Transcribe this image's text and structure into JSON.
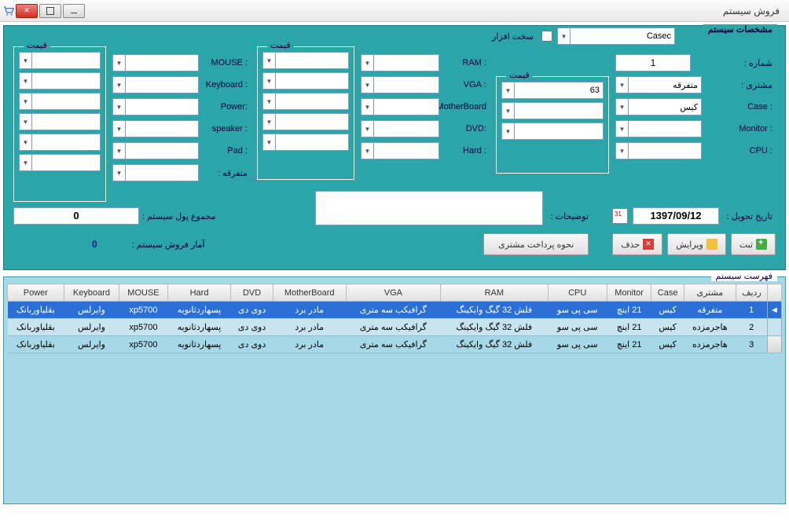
{
  "window": {
    "title": "فروش سیستم"
  },
  "specs": {
    "group_title": "مشخصات سیستم",
    "hardware_label": "سخت افزار",
    "hardware_value": "Casec",
    "number_label": "شماره :",
    "number_value": "1",
    "customer_label": "مشتری :",
    "customer_value": "متفرقه",
    "case_label": ": Case",
    "case_value": "کیس",
    "monitor_label": ": Monitor",
    "cpu_label": ": CPU",
    "price_group": "قیمت",
    "price_case": "63",
    "ram_label": ": RAM",
    "vga_label": ": VGA",
    "mb_label": "MotherBoard",
    "dvd_label": ":DVD",
    "hard_label": ": Hard",
    "mouse_label": ": MOUSE",
    "keyboard_label": ": Keyboard",
    "power_label": ":Power",
    "speaker_label": ": speaker",
    "pad_label": ": Pad",
    "misc_label": "متفرقه :",
    "delivery_label": "تاریخ تحویل :",
    "delivery_value": "1397/09/12",
    "desc_label": "توضیحات :",
    "total_label": "مجموع پول سیستم :",
    "total_value": "0",
    "stat_label": "آمار فروش سیستم :",
    "stat_value": "0"
  },
  "buttons": {
    "save": "ثبت",
    "edit": "ویرایش",
    "delete": "حذف",
    "pay": "نحوه پرداخت مشتری"
  },
  "list": {
    "group_title": "فهرست سیستم",
    "headers": [
      "ردیف",
      "مشتری",
      "Case",
      "Monitor",
      "CPU",
      "RAM",
      "VGA",
      "MotherBoard",
      "DVD",
      "Hard",
      "MOUSE",
      "Keyboard",
      "Power"
    ],
    "rows": [
      [
        "1",
        "متفرقه",
        "کیس",
        "21 اینچ",
        "سی پی سو",
        "فلش 32 گیگ وایکینگ",
        "گرافیکب سه متری",
        "مادر برد",
        "دوی دی",
        "پسهاردثانویه",
        "xp5700",
        "وایرلس",
        "بقلیاوربانک"
      ],
      [
        "2",
        "هاجرمزده",
        "کیس",
        "21 اینچ",
        "سی پی سو",
        "فلش 32 گیگ وایکینگ",
        "گرافیکب سه متری",
        "مادر برد",
        "دوی دی",
        "پسهاردثانویه",
        "xp5700",
        "وایرلس",
        "بقلیاوربانک"
      ],
      [
        "3",
        "هاجرمزده",
        "کیس",
        "21 اینچ",
        "سی پی سو",
        "فلش 32 گیگ وایکینگ",
        "گرافیکب سه متری",
        "مادر برد",
        "دوی دی",
        "پسهاردثانویه",
        "xp5700",
        "وایرلس",
        "بقلیاوربانک"
      ]
    ]
  }
}
